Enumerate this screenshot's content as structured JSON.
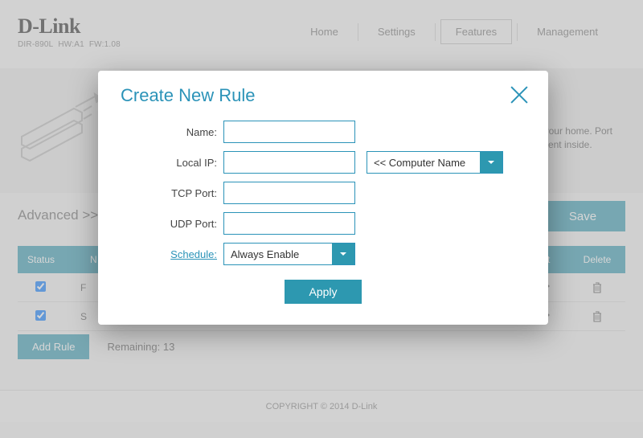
{
  "brand": {
    "logo": "D-Link",
    "model": "DIR-890L",
    "hw": "HW:A1",
    "fw": "FW:1.08"
  },
  "nav": {
    "home": "Home",
    "settings": "Settings",
    "features": "Features",
    "management": "Management"
  },
  "hero": {
    "line1": "your home. Port",
    "line2": "lient inside."
  },
  "breadcrumb": "Advanced >> P",
  "save_label": "Save",
  "table": {
    "headers": {
      "status": "Status",
      "name": "N",
      "edit": "dit",
      "delete": "Delete"
    },
    "rows": [
      {
        "checked": true,
        "name": "F"
      },
      {
        "checked": true,
        "name": "S"
      }
    ]
  },
  "add_rule_label": "Add Rule",
  "remaining_label": "Remaining: 13",
  "copyright": "COPYRIGHT © 2014 D-Link",
  "modal": {
    "title": "Create New Rule",
    "labels": {
      "name": "Name:",
      "local_ip": "Local IP:",
      "tcp_port": "TCP Port:",
      "udp_port": "UDP Port:",
      "schedule": "Schedule:"
    },
    "fields": {
      "name": "",
      "local_ip": "",
      "tcp_port": "",
      "udp_port": ""
    },
    "dropdowns": {
      "computer_name": "<< Computer Name",
      "schedule": "Always Enable"
    },
    "apply_label": "Apply"
  }
}
